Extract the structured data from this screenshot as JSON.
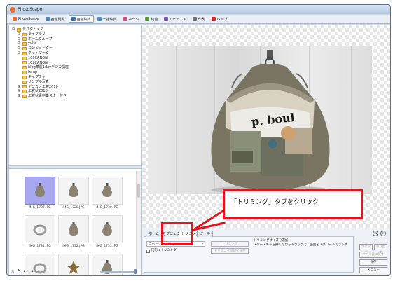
{
  "window": {
    "title": "PhotoScape"
  },
  "tabs": [
    {
      "label": "PhotoScape",
      "icon": "photoscape-icon",
      "color": "#e36d2b",
      "active": false
    },
    {
      "label": "画像閲覧",
      "icon": "viewer-icon",
      "color": "#4a7fc1",
      "active": false
    },
    {
      "label": "画像編集",
      "icon": "editor-icon",
      "color": "#3e6fb0",
      "active": true
    },
    {
      "label": "一括編集",
      "icon": "batch-icon",
      "color": "#4b8fd0",
      "active": false
    },
    {
      "label": "ページ",
      "icon": "page-icon",
      "color": "#c94f7a",
      "active": false
    },
    {
      "label": "結合",
      "icon": "combine-icon",
      "color": "#5a9a3d",
      "active": false
    },
    {
      "label": "GIFアニメ",
      "icon": "gif-icon",
      "color": "#7a57b3",
      "active": false
    },
    {
      "label": "印刷",
      "icon": "print-icon",
      "color": "#6b6b6b",
      "active": false
    },
    {
      "label": "ヘルプ",
      "icon": "help-icon",
      "color": "#d82020",
      "active": false
    }
  ],
  "tree": [
    {
      "label": "デスクトップ",
      "indent": 0,
      "expander": "⊟"
    },
    {
      "label": "ライブラリ",
      "indent": 1,
      "expander": "⊞"
    },
    {
      "label": "ホームグループ",
      "indent": 1,
      "expander": "⊞"
    },
    {
      "label": "yuko",
      "indent": 1,
      "expander": "⊞"
    },
    {
      "label": "コンピューター",
      "indent": 1,
      "expander": "⊞"
    },
    {
      "label": "ネットワーク",
      "indent": 1,
      "expander": "⊞"
    },
    {
      "label": "100CANON",
      "indent": 1,
      "expander": ""
    },
    {
      "label": "102CANON",
      "indent": 1,
      "expander": ""
    },
    {
      "label": "blog華麗1dayデジカ講座",
      "indent": 1,
      "expander": ""
    },
    {
      "label": "temp",
      "indent": 1,
      "expander": ""
    },
    {
      "label": "キャプチャ",
      "indent": 1,
      "expander": ""
    },
    {
      "label": "サンプル写真",
      "indent": 1,
      "expander": ""
    },
    {
      "label": "デジカメ年賀2016",
      "indent": 1,
      "expander": "⊞"
    },
    {
      "label": "年賀状2016",
      "indent": 1,
      "expander": "⊞"
    },
    {
      "label": "年賀状素材集スター付き",
      "indent": 1,
      "expander": "⊞"
    }
  ],
  "thumbnails": [
    {
      "name": "IMG_1727.JPG",
      "selected": true
    },
    {
      "name": "IMG_1728.JPG",
      "selected": false
    },
    {
      "name": "IMG_1730.JPG",
      "selected": false
    },
    {
      "name": "IMG_1731.JPG",
      "selected": false
    },
    {
      "name": "IMG_1732.JPG",
      "selected": false
    },
    {
      "name": "IMG_1733.JPG",
      "selected": false
    },
    {
      "name": "IMG_1734.JPG",
      "selected": false
    },
    {
      "name": "IMG_1735.JPG",
      "selected": false
    },
    {
      "name": "IMG_1736.JPG",
      "selected": false
    }
  ],
  "photo": {
    "bag_text": "p. boul"
  },
  "panel": {
    "tabs": [
      "ホーム",
      "オブジェクト",
      "トリミング",
      "ツール"
    ],
    "active_tab": "トリミング",
    "dropdown_value": "自由トリミング",
    "crop_button": "トリミング",
    "crop_save_button": "トリミング領域を保存",
    "round_crop_label": "円形にトリミング",
    "help_line1": "トリミングサイズを選択",
    "help_line2": "スペースキーを押しながらドラッグで、画面をスクロールできます"
  },
  "side_buttons": {
    "undo": "元に戻す",
    "redo": "やり直す",
    "undo_all": "すべて元に戻す",
    "save": "保存",
    "menu": "メニュー"
  },
  "annotation": {
    "text": "「トリミング」タブをクリック",
    "color": "#e6131b"
  }
}
